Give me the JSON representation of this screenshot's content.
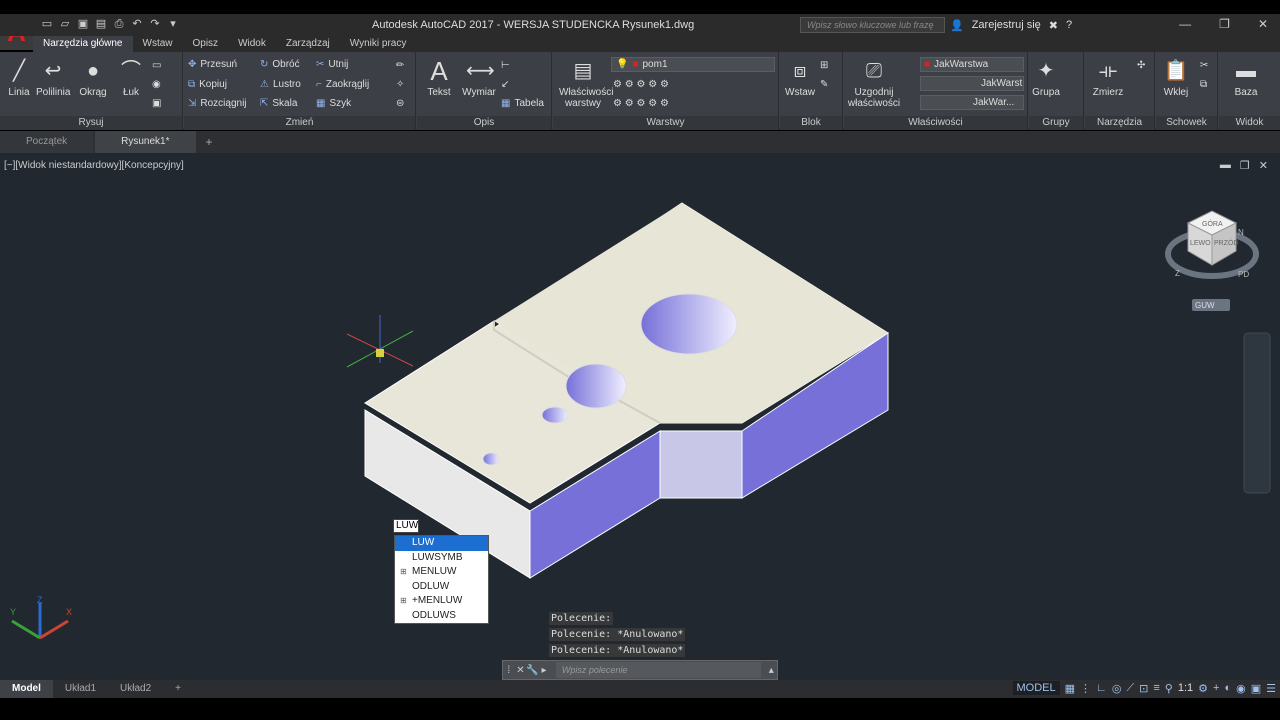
{
  "titlebar": {
    "title": "Autodesk AutoCAD 2017 - WERSJA STUDENCKA    Rysunek1.dwg",
    "search_placeholder": "Wpisz słowo kluczowe lub frazę",
    "signin": "Zarejestruj się"
  },
  "tabs": [
    "Narzędzia główne",
    "Wstaw",
    "Opisz",
    "Widok",
    "Zarządzaj",
    "Wyniki pracy"
  ],
  "ribbon": {
    "draw": {
      "label": "Rysuj",
      "line": "Linia",
      "polyline": "Polilinia",
      "circle": "Okrąg",
      "arc": "Łuk"
    },
    "modify": {
      "label": "Zmień",
      "move": "Przesuń",
      "rotate": "Obróć",
      "trim": "Utnij",
      "copy": "Kopiuj",
      "mirror": "Lustro",
      "fillet": "Zaokrąglij",
      "stretch": "Rozciągnij",
      "scale": "Skala",
      "array": "Szyk"
    },
    "annotation": {
      "label": "Opis",
      "text": "Tekst",
      "dimension": "Wymiar",
      "table": "Tabela"
    },
    "layers": {
      "label": "Warstwy",
      "props": "Właściwości warstwy",
      "current": "pom1"
    },
    "block": {
      "label": "Blok",
      "insert": "Wstaw"
    },
    "properties": {
      "label": "Właściwości",
      "match": "Uzgodnij właściwości",
      "color": "JakWarstwa",
      "linetype": "JakWarst",
      "lineweight": "JakWar..."
    },
    "groups": {
      "label": "Grupy",
      "group": "Grupa"
    },
    "utilities": {
      "label": "Narzędzia",
      "measure": "Zmierz"
    },
    "clipboard": {
      "label": "Schowek",
      "paste": "Wklej"
    },
    "view": {
      "label": "Widok",
      "base": "Baza"
    }
  },
  "doctabs": [
    "Początek",
    "Rysunek1*"
  ],
  "viewport": {
    "label": "[−][Widok niestandardowy][Koncepcyjny]",
    "viewcube_top": "GÓRA",
    "viewcube_left": "LEWO",
    "viewcube_front": "PRZÓD",
    "compass_n": "N",
    "compass_s": "PD",
    "compass_w": "Z",
    "wcs": "GUW"
  },
  "autocomplete": {
    "input": "LUW",
    "items": [
      "LUW",
      "LUWSYMB",
      "MENLUW",
      "ODLUW",
      "+MENLUW",
      "ODLUWS"
    ]
  },
  "history": [
    "Polecenie:",
    "Polecenie: *Anulowano*",
    "Polecenie: *Anulowano*"
  ],
  "command": {
    "placeholder": "Wpisz polecenie"
  },
  "layouts": [
    "Model",
    "Układ1",
    "Układ2"
  ],
  "status": {
    "model": "MODEL",
    "scale": "1:1"
  }
}
